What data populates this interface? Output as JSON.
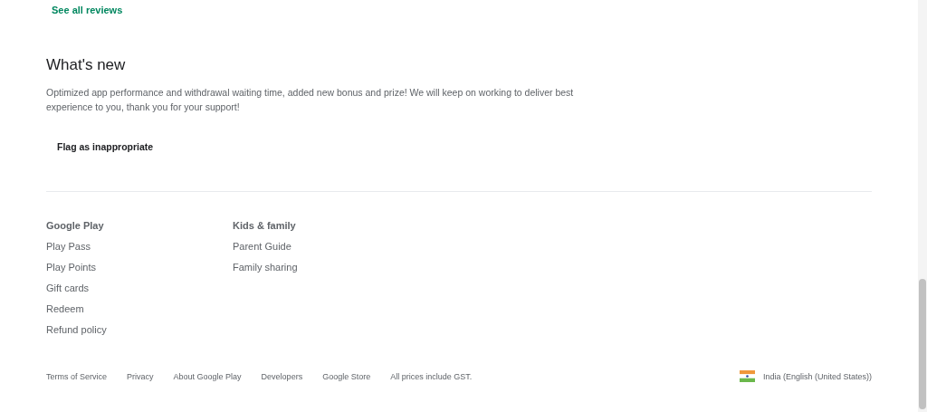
{
  "reviews_link": "See all reviews",
  "whats_new": {
    "title": "What's new",
    "text": "Optimized app performance and withdrawal waiting time, added new bonus and prize! We will keep on working to deliver best experience to you, thank you for your support!"
  },
  "flag_button": "Flag as inappropriate",
  "footer_columns": [
    {
      "heading": "Google Play",
      "links": [
        "Play Pass",
        "Play Points",
        "Gift cards",
        "Redeem",
        "Refund policy"
      ]
    },
    {
      "heading": "Kids & family",
      "links": [
        "Parent Guide",
        "Family sharing"
      ]
    }
  ],
  "bottom_links": [
    "Terms of Service",
    "Privacy",
    "About Google Play",
    "Developers",
    "Google Store"
  ],
  "price_note": "All prices include GST.",
  "locale": "India (English (United States))"
}
